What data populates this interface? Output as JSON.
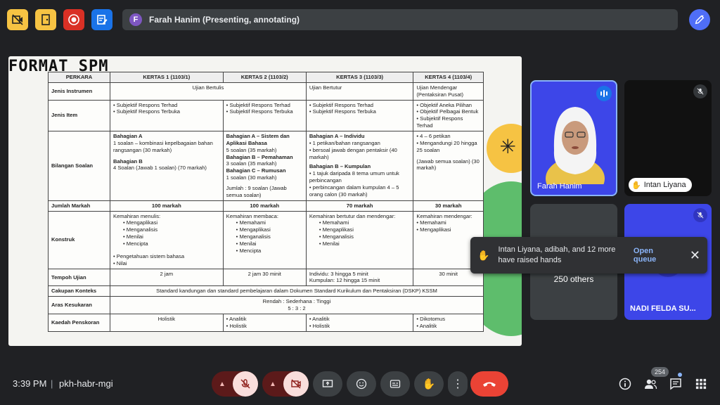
{
  "topbar": {
    "presenter_initial": "F",
    "presenting_text": "Farah Hanim (Presenting, annotating)",
    "colors": {
      "yellow": "#f6c343",
      "red": "#d93025",
      "blue": "#1a73e8",
      "pen": "#4f6ef7"
    }
  },
  "slide": {
    "title": "FORMAT SPM",
    "table": {
      "headers": [
        "PERKARA",
        "KERTAS 1 (1103/1)",
        "KERTAS 2 (1103/2)",
        "KERTAS 3 (1103/3)",
        "KERTAS 4 (1103/4)"
      ],
      "jenis_instrumen": {
        "label": "Jenis Instrumen",
        "k12": "Ujian Bertulis",
        "k3": "Ujian Bertutur",
        "k4": "Ujian Mendengar (Pentaksiran Pusat)"
      },
      "jenis_item": {
        "label": "Jenis Item",
        "k1": [
          "Subjektif Respons Terhad",
          "Subjektif Respons Terbuka"
        ],
        "k2": [
          "Subjektif Respons Terhad",
          "Subjektif Respons Terbuka"
        ],
        "k3": [
          "Subjektif Respons Terhad",
          "Subjektif Respons Terbuka"
        ],
        "k4": [
          "Objektif Aneka Pilihan",
          "Objektif Pelbagai Bentuk",
          "Subjektif Respons Terhad"
        ]
      },
      "bilangan": {
        "label": "Bilangan Soalan",
        "k1_a_title": "Bahagian A",
        "k1_a_text": "1 soalan – kombinasi kepelbagaian bahan rangsangan (30 markah)",
        "k1_b_title": "Bahagian B",
        "k1_b_text": "4 Soalan (Jawab 1 soalan) (70 markah)",
        "k2_a_title": "Bahagian A – Sistem dan Aplikasi Bahasa",
        "k2_a_text": "5 soalan (35 markah)",
        "k2_b_title": "Bahagian B – Pemahaman",
        "k2_b_text": "3 soalan (35 markah)",
        "k2_c_title": "Bahagian C – Rumusan",
        "k2_c_text": "1 soalan (30 markah)",
        "k2_jumlah": "Jumlah : 9 soalan (Jawab semua soalan)",
        "k3_a_title": "Bahagian A – Individu",
        "k3_a_items": [
          "1 petikan/bahan rangsangan",
          "bersoal jawab dengan pentaksir (40 markah)"
        ],
        "k3_b_title": "Bahagian B – Kumpulan",
        "k3_b_items": [
          "1 tajuk daripada 8 tema umum untuk perbincangan",
          "perbincangan dalam kumpulan 4 – 5 orang calon (30 markah)"
        ],
        "k4_items": [
          "4 – 6 petikan",
          "Mengandungi 20 hingga 25 soalan"
        ],
        "k4_note": "(Jawab semua soalan) (30 markah)"
      },
      "jumlah_markah": {
        "label": "Jumlah Markah",
        "k1": "100 markah",
        "k2": "100 markah",
        "k3": "70 markah",
        "k4": "30 markah"
      },
      "konstruk": {
        "label": "Konstruk",
        "k1_title": "Kemahiran menulis:",
        "k1_items": [
          "Mengaplikasi",
          "Menganalisis",
          "Menilai",
          "Mencipta"
        ],
        "k2_title": "Kemahiran membaca:",
        "k2_items": [
          "Memahami",
          "Mengaplikasi",
          "Menganalisis",
          "Menilai",
          "Mencipta"
        ],
        "k3_title": "Kemahiran bertutur dan mendengar:",
        "k3_items": [
          "Memahami",
          "Mengaplikasi",
          "Menganalisis",
          "Menilai"
        ],
        "k4_title": "Kemahiran mendengar:",
        "k4_items": [
          "Memahami",
          "Mengaplikasi"
        ],
        "shared_items": [
          "Pengetahuan sistem bahasa",
          "Nilai"
        ]
      },
      "tempoh": {
        "label": "Tempoh Ujian",
        "k1": "2 jam",
        "k2": "2 jam 30 minit",
        "k3_a": "Individu: 3 hingga 5 minit",
        "k3_b": "Kumpulan: 12 hingga 15 minit",
        "k4": "30 minit"
      },
      "cakupan": {
        "label": "Cakupan Konteks",
        "text": "Standard kandungan dan standard pembelajaran dalam Dokumen Standard Kurikulum dan Pentaksiran (DSKP) KSSM"
      },
      "aras": {
        "label": "Aras Kesukaran",
        "text1": "Rendah : Sederhana : Tinggi",
        "text2": "5 : 3 : 2"
      },
      "kaedah": {
        "label": "Kaedah Penskoran",
        "k1": "Holistik",
        "k2": [
          "Analitik",
          "Holistik"
        ],
        "k3": [
          "Analitik",
          "Holistik"
        ],
        "k4": [
          "Dikotomus",
          "Analitik"
        ]
      }
    }
  },
  "tiles": {
    "farah_name": "Farah Hanim",
    "intan_name": "Intan Liyana",
    "others_text": "250 others",
    "nadi_name": "NADI FELDA SU..."
  },
  "toast": {
    "message": "Intan Liyana, adibah, and 12 more have raised hands",
    "action": "Open queue"
  },
  "bottombar": {
    "time": "3:39 PM",
    "separator": "|",
    "meeting_code": "pkh-habr-mgi",
    "people_count": "254"
  }
}
